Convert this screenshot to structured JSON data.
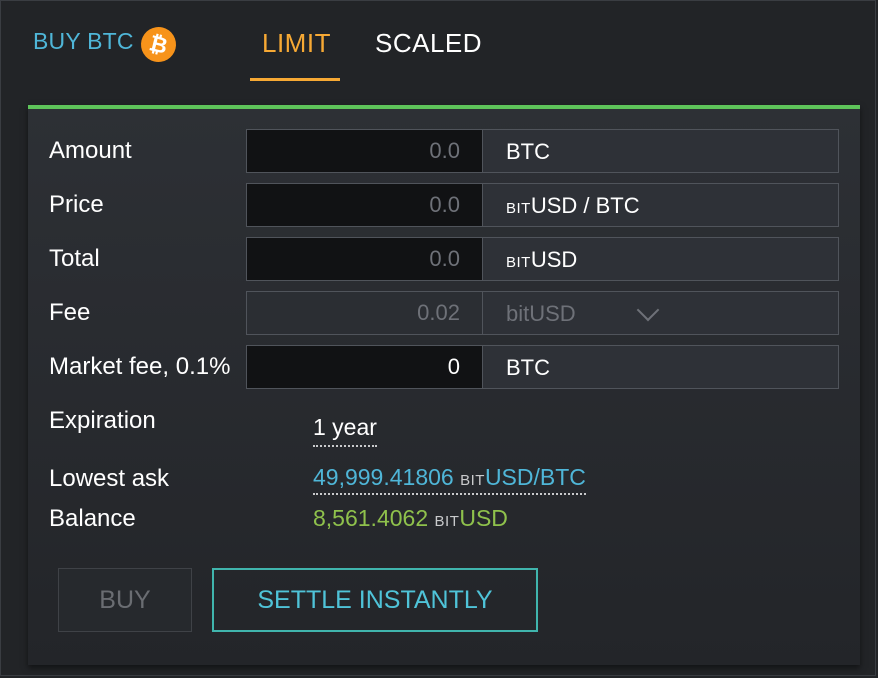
{
  "header": {
    "title": "BUY BTC",
    "coin_icon": "bitcoin-icon",
    "tabs": [
      {
        "label": "LIMIT",
        "active": true
      },
      {
        "label": "SCALED",
        "active": false
      }
    ]
  },
  "form": {
    "amount": {
      "label": "Amount",
      "value": "0.0",
      "unit": "BTC"
    },
    "price": {
      "label": "Price",
      "value": "0.0",
      "unit_prefix": "BIT",
      "unit": "USD / BTC"
    },
    "total": {
      "label": "Total",
      "value": "0.0",
      "unit_prefix": "BIT",
      "unit": "USD"
    },
    "fee": {
      "label": "Fee",
      "value": "0.02",
      "unit": "bitUSD"
    },
    "market_fee": {
      "label": "Market fee, 0.1%",
      "value": "0",
      "unit": "BTC"
    },
    "expiration": {
      "label": "Expiration",
      "value": "1 year"
    },
    "lowest_ask": {
      "label": "Lowest ask",
      "value": "49,999.41806",
      "unit_prefix": "BIT",
      "unit": "USD/BTC"
    },
    "balance": {
      "label": "Balance",
      "value": "8,561.4062",
      "unit_prefix": "BIT",
      "unit": "USD"
    }
  },
  "actions": {
    "buy_label": "BUY",
    "settle_label": "SETTLE INSTANTLY"
  },
  "colors": {
    "accent_orange": "#f7a934",
    "link_blue": "#4fb6d8",
    "balance_green": "#8fc14c",
    "panel_top_green": "#5ec45a",
    "settle_teal": "#40b5ad"
  }
}
